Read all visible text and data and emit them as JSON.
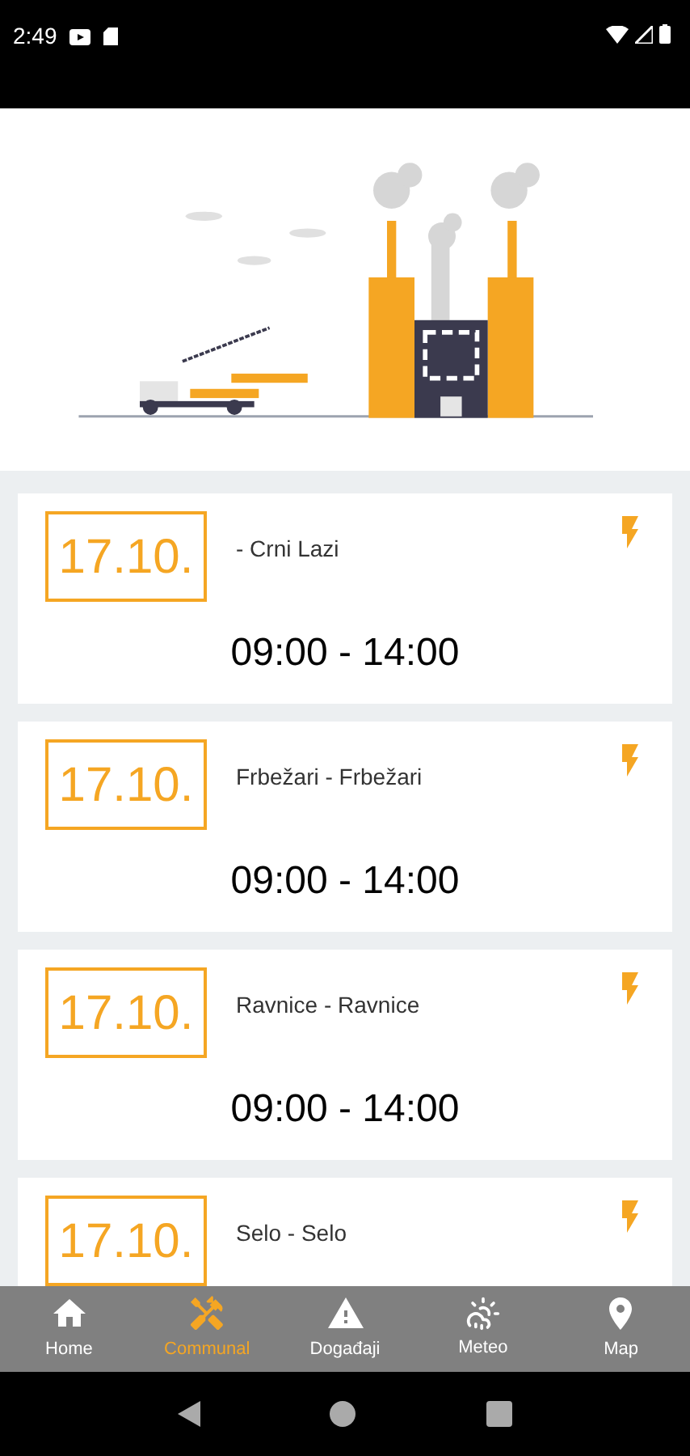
{
  "status_bar": {
    "time": "2:49"
  },
  "outages": [
    {
      "date": "17.10.",
      "place": "- Crni Lazi",
      "time": "09:00 - 14:00"
    },
    {
      "date": "17.10.",
      "place": "Frbežari - Frbežari",
      "time": "09:00 - 14:00"
    },
    {
      "date": "17.10.",
      "place": "Ravnice - Ravnice",
      "time": "09:00 - 14:00"
    },
    {
      "date": "17.10.",
      "place": "Selo - Selo"
    }
  ],
  "bottom_nav": [
    {
      "label": "Home",
      "selected": false
    },
    {
      "label": "Communal",
      "selected": true
    },
    {
      "label": "Događaji",
      "selected": false
    },
    {
      "label": "Meteo",
      "selected": false
    },
    {
      "label": "Map",
      "selected": false
    }
  ]
}
